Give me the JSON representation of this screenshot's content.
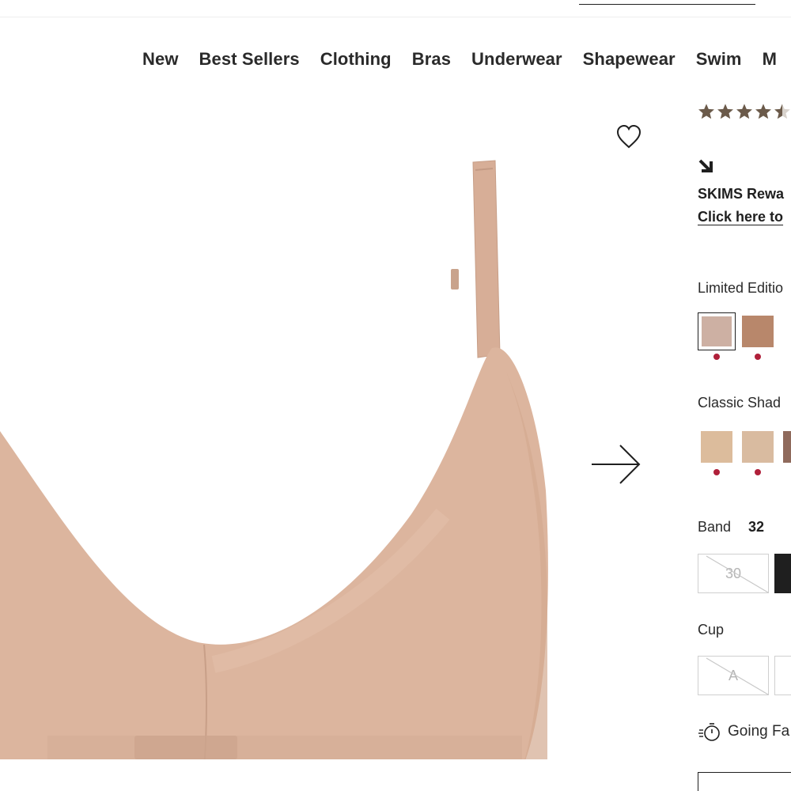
{
  "nav": {
    "items": [
      "New",
      "Best Sellers",
      "Clothing",
      "Bras",
      "Underwear",
      "Shapewear",
      "Swim",
      "M"
    ]
  },
  "gallery": {
    "wishlist_icon": "heart-outline-icon",
    "next_icon": "arrow-right-icon"
  },
  "product": {
    "rating": 4.5,
    "rating_max": 5,
    "star_color": "#6b5a4a",
    "rewards_title": "SKIMS Rewa",
    "rewards_link": "Click here to",
    "limited_label": "Limited Editio",
    "limited_swatches": [
      {
        "color": "#cdb0a3",
        "selected": true,
        "dot_color": "#b0203a"
      },
      {
        "color": "#b8876b",
        "selected": false,
        "dot_color": "#b0203a"
      }
    ],
    "classic_label": "Classic Shad",
    "classic_swatches": [
      {
        "color": "#dcbc9c",
        "selected": false,
        "dot_color": "#b0203a"
      },
      {
        "color": "#d9bba0",
        "selected": false,
        "dot_color": "#b0203a"
      },
      {
        "color": "#8f6a5c",
        "selected": false,
        "dot_color": null
      }
    ],
    "band_label": "Band",
    "band_selected": "32",
    "band_options": [
      {
        "label": "30",
        "unavailable": true
      },
      {
        "label": "",
        "unavailable": false,
        "selected": true
      }
    ],
    "cup_label": "Cup",
    "cup_options": [
      {
        "label": "A",
        "unavailable": true
      },
      {
        "label": "",
        "unavailable": false
      }
    ],
    "shipping_text": "Going Fa",
    "bra_color": "#dcb59e"
  }
}
